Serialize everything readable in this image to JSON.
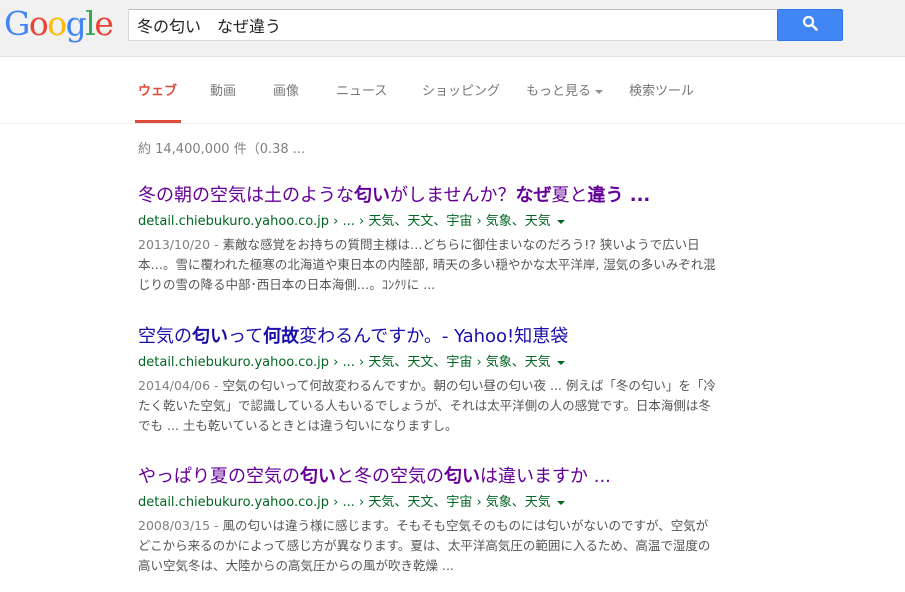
{
  "logo": {
    "letters": [
      "G",
      "o",
      "o",
      "g",
      "l",
      "e"
    ],
    "colors": [
      "#4285f4",
      "#ea4335",
      "#fbbc05",
      "#4285f4",
      "#34a853",
      "#ea4335"
    ]
  },
  "search": {
    "value": "冬の匂い　なぜ違う",
    "button_icon": "search-icon"
  },
  "nav": {
    "items": [
      "ウェブ",
      "動画",
      "画像",
      "ニュース",
      "ショッピング",
      "もっと見る",
      "検索ツール"
    ],
    "active_index": 0,
    "active_color": "#dd4b39"
  },
  "stats": "約 14,400,000 件（0.38 ...",
  "results": [
    {
      "title_parts": [
        {
          "t": "冬の朝の空気は土のような",
          "b": false
        },
        {
          "t": "匂い",
          "b": true
        },
        {
          "t": "がしませんか？",
          "b": false
        },
        {
          "t": "なぜ",
          "b": true
        },
        {
          "t": "夏と",
          "b": false
        },
        {
          "t": "違う",
          "b": true
        },
        {
          "t": " ...",
          "b": false
        }
      ],
      "url": "detail.chiebukuro.yahoo.co.jp › ... › 天気、天文、宇宙 › 気象、天気",
      "date": "2013/10/20 - ",
      "snippet": "素敵な感覚をお持ちの質問主様は…どちらに御住まいなのだろう!? 狭いようで広い日本…。雪に覆われた極寒の北海道や東日本の内陸部, 晴天の多い穏やかな太平洋岸, 湿気の多いみぞれ混じりの雪の降る中部･西日本の日本海側…。ｺﾝｸﾘに ..."
    },
    {
      "title_parts": [
        {
          "t": "空気の",
          "b": false
        },
        {
          "t": "匂い",
          "b": true
        },
        {
          "t": "って",
          "b": false
        },
        {
          "t": "何故",
          "b": true
        },
        {
          "t": "変わるんですか。- Yahoo!知恵袋",
          "b": false
        }
      ],
      "url": "detail.chiebukuro.yahoo.co.jp › ... › 天気、天文、宇宙 › 気象、天気",
      "date": "2014/04/06 - ",
      "snippet": "空気の匂いって何故変わるんですか。朝の匂い昼の匂い夜 ... 例えば「冬の匂い」を「冷たく乾いた空気」で認識している人もいるでしょうが、それは太平洋側の人の感覚です。日本海側は冬でも ... 土も乾いているときとは違う匂いになりますし。"
    },
    {
      "title_parts": [
        {
          "t": "やっぱり夏の空気の",
          "b": false
        },
        {
          "t": "匂い",
          "b": true
        },
        {
          "t": "と冬の空気の",
          "b": false
        },
        {
          "t": "匂い",
          "b": true
        },
        {
          "t": "は違いますか ...",
          "b": false
        }
      ],
      "url": "detail.chiebukuro.yahoo.co.jp › ... › 天気、天文、宇宙 › 気象、天気",
      "date": "2008/03/15 - ",
      "snippet": "風の匂いは違う様に感じます。そもそも空気そのものには匂いがないのですが、空気がどこから来るのかによって感じ方が異なります。夏は、太平洋高気圧の範囲に入るため、高温で湿度の高い空気冬は、大陸からの高気圧からの風が吹き乾燥 ..."
    }
  ]
}
